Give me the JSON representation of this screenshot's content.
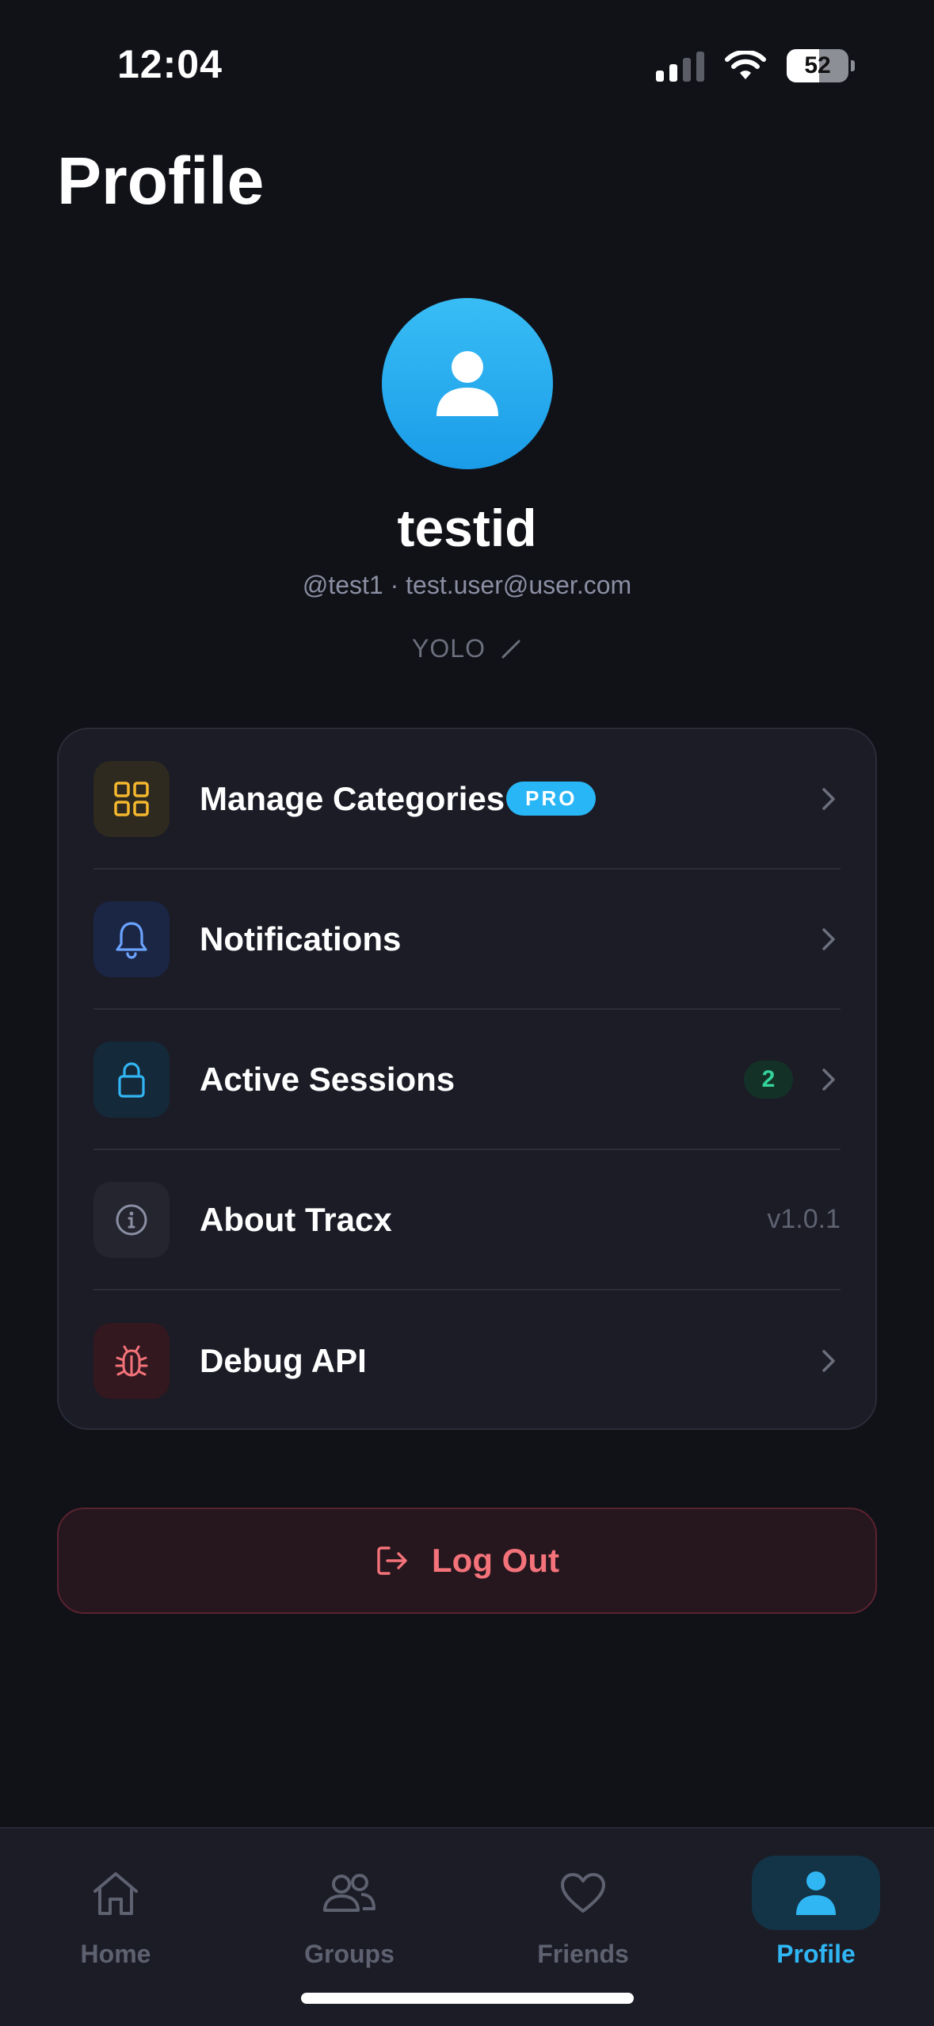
{
  "status_bar": {
    "time": "12:04",
    "battery": "52"
  },
  "page": {
    "title": "Profile"
  },
  "profile": {
    "name": "testid",
    "handle_line": "@test1 · test.user@user.com",
    "bio": "YOLO"
  },
  "menu": {
    "items": [
      {
        "label": "Manage Categories",
        "badge": "PRO",
        "icon": "grid-icon"
      },
      {
        "label": "Notifications",
        "icon": "bell-icon"
      },
      {
        "label": "Active Sessions",
        "count": "2",
        "icon": "lock-icon"
      },
      {
        "label": "About Tracx",
        "value": "v1.0.1",
        "icon": "info-icon"
      },
      {
        "label": "Debug API",
        "icon": "bug-icon"
      }
    ]
  },
  "logout": {
    "label": "Log Out"
  },
  "tabs": [
    {
      "label": "Home",
      "icon": "home-icon"
    },
    {
      "label": "Groups",
      "icon": "users-icon"
    },
    {
      "label": "Friends",
      "icon": "heart-icon"
    },
    {
      "label": "Profile",
      "icon": "person-icon",
      "active": true
    }
  ],
  "colors": {
    "background": "#111218",
    "card": "#1b1c26",
    "accent": "#29b6f6",
    "danger": "#f4737a",
    "success": "#34d399"
  }
}
